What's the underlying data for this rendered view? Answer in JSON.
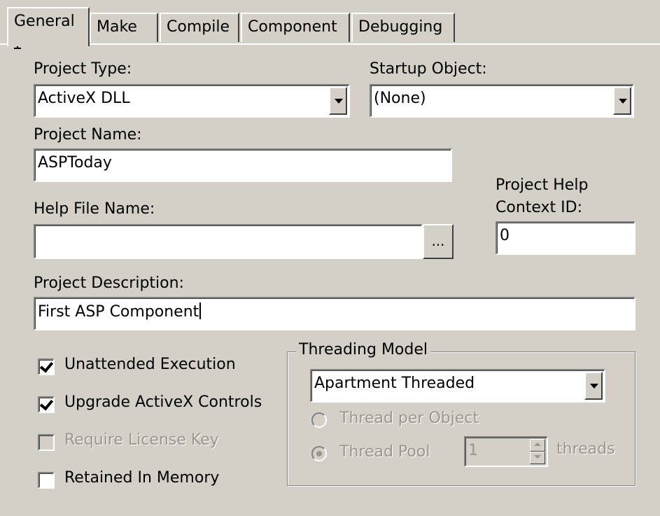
{
  "tabs": [
    {
      "label": "General",
      "active": true
    },
    {
      "label": "Make",
      "active": false
    },
    {
      "label": "Compile",
      "active": false
    },
    {
      "label": "Component",
      "active": false
    },
    {
      "label": "Debugging",
      "active": false
    }
  ],
  "project_type": {
    "label": "Project Type:",
    "value": "ActiveX DLL"
  },
  "startup_object": {
    "label": "Startup Object:",
    "value": "(None)"
  },
  "project_name": {
    "label": "Project Name:",
    "value": "ASPToday"
  },
  "help_file": {
    "label": "Help File Name:",
    "value": "",
    "browse_label": "..."
  },
  "help_context": {
    "label_line1": "Project Help",
    "label_line2": "Context ID:",
    "value": "0"
  },
  "project_description": {
    "label": "Project Description:",
    "value": "First ASP Component"
  },
  "options": {
    "unattended": {
      "label": "Unattended Execution",
      "checked": true,
      "enabled": true
    },
    "upgrade_activex": {
      "label": "Upgrade ActiveX Controls",
      "checked": true,
      "enabled": true
    },
    "require_license": {
      "label": "Require License Key",
      "checked": false,
      "enabled": false
    },
    "retained_memory": {
      "label": "Retained In Memory",
      "checked": false,
      "enabled": true
    }
  },
  "threading": {
    "group_label": "Threading Model",
    "model_value": "Apartment Threaded",
    "thread_per_object_label": "Thread per Object",
    "thread_pool_label": "Thread Pool",
    "pool_count": "1",
    "threads_label": "threads",
    "selected": "thread_pool",
    "enabled": false
  },
  "colors": {
    "face": "#d4d0c8",
    "disabled_text": "#9a968e",
    "field": "#ffffff"
  }
}
